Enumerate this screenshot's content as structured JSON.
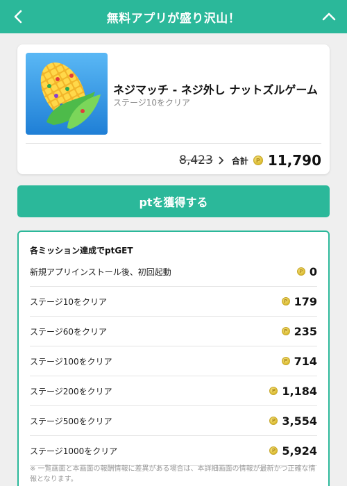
{
  "header": {
    "title": "無料アプリが盛り沢山！",
    "back_icon": "chevron-left-icon",
    "collapse_icon": "chevron-up-icon",
    "bg_color": "#2bb89a"
  },
  "app": {
    "name": "ネジマッチ - ネジ外し ナットズルゲーム",
    "subtitle": "ステージ10をクリア",
    "icon": "corn-game-icon",
    "old_points": "8,423",
    "total_label": "合計",
    "total_points": "11,790"
  },
  "cta": {
    "label": "ptを獲得する"
  },
  "missions": {
    "title": "各ミッション達成でptGET",
    "items": [
      {
        "label": "新規アプリインストール後、初回起動",
        "value": "0"
      },
      {
        "label": "ステージ10をクリア",
        "value": "179"
      },
      {
        "label": "ステージ60をクリア",
        "value": "235"
      },
      {
        "label": "ステージ100をクリア",
        "value": "714"
      },
      {
        "label": "ステージ200をクリア",
        "value": "1,184"
      },
      {
        "label": "ステージ500をクリア",
        "value": "3,554"
      },
      {
        "label": "ステージ1000をクリア",
        "value": "5,924"
      }
    ],
    "note": "※ 一覧画面と本画面の報酬情報に差異がある場合は、本詳細画面の情報が最新かつ正確な情報となります。"
  },
  "colors": {
    "accent": "#2bb89a",
    "coin": "#e0c23a"
  }
}
